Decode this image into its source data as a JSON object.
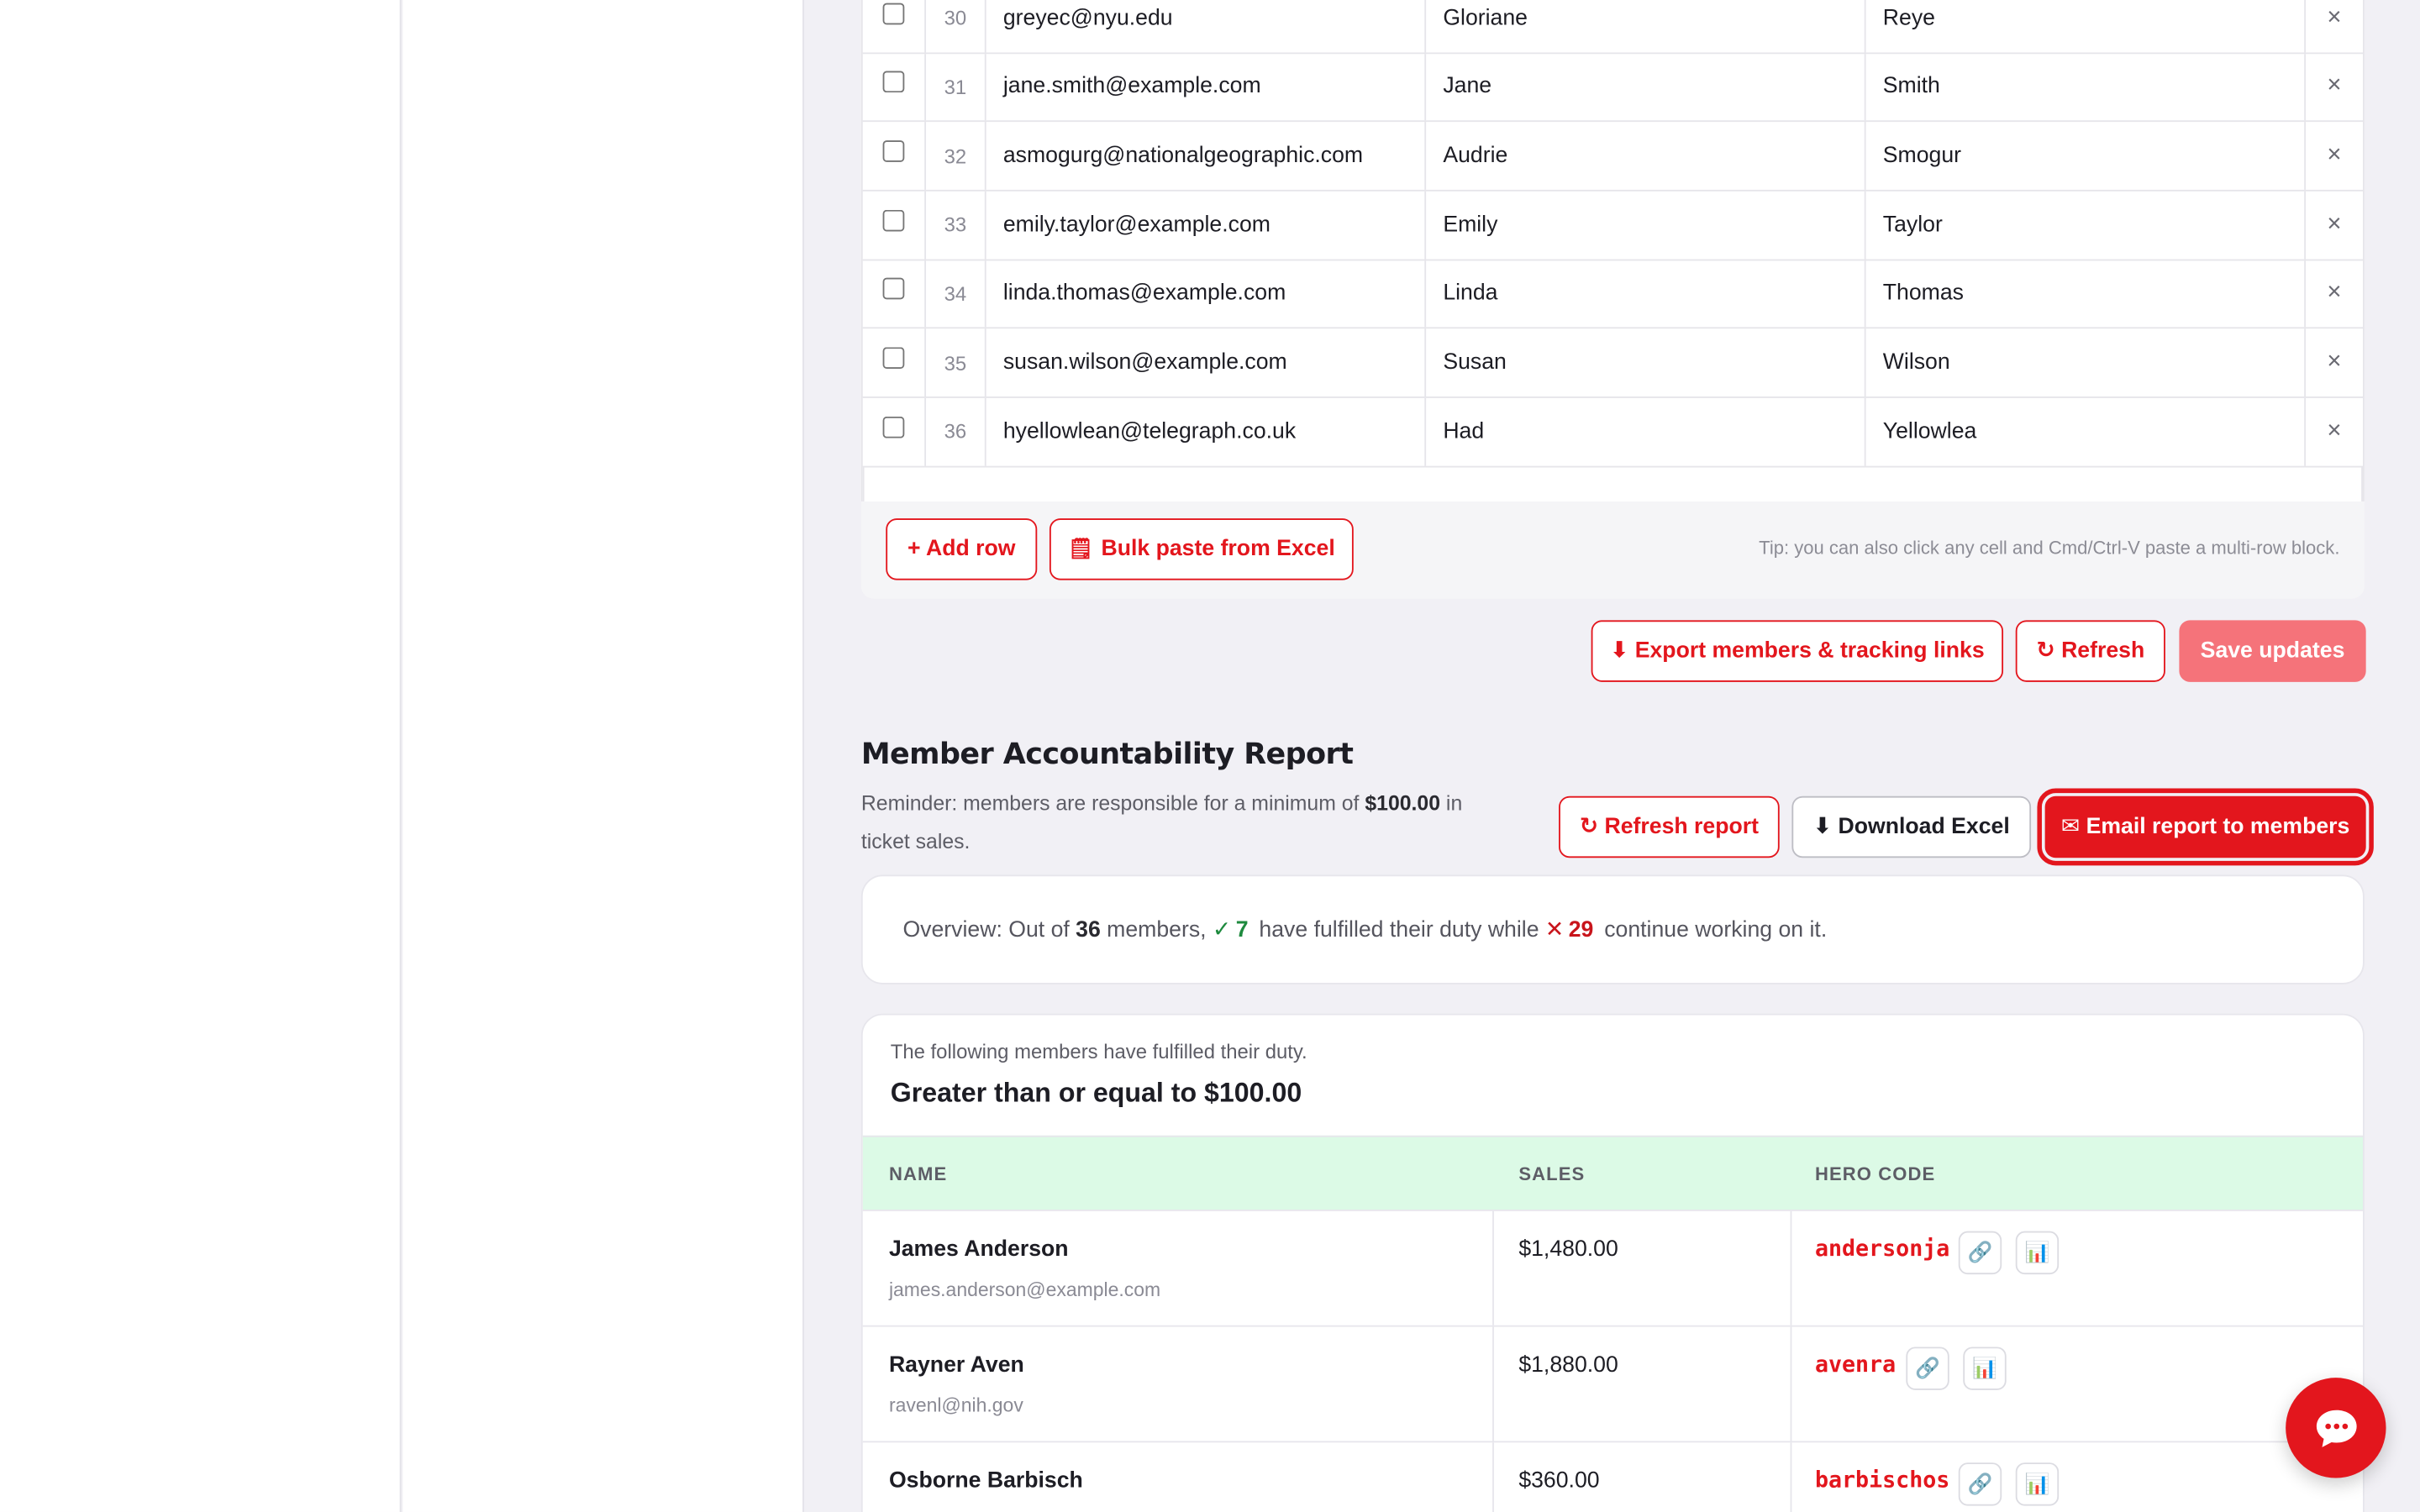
{
  "members_table": {
    "rows": [
      {
        "num": "30",
        "email": "greyec@nyu.edu",
        "first": "Gloriane",
        "last": "Reye"
      },
      {
        "num": "31",
        "email": "jane.smith@example.com",
        "first": "Jane",
        "last": "Smith"
      },
      {
        "num": "32",
        "email": "asmogurg@nationalgeographic.com",
        "first": "Audrie",
        "last": "Smogur"
      },
      {
        "num": "33",
        "email": "emily.taylor@example.com",
        "first": "Emily",
        "last": "Taylor"
      },
      {
        "num": "34",
        "email": "linda.thomas@example.com",
        "first": "Linda",
        "last": "Thomas"
      },
      {
        "num": "35",
        "email": "susan.wilson@example.com",
        "first": "Susan",
        "last": "Wilson"
      },
      {
        "num": "36",
        "email": "hyellowlean@telegraph.co.uk",
        "first": "Had",
        "last": "Yellowlea"
      }
    ],
    "delete_glyph": "×",
    "add_row_label": "+ Add row",
    "bulk_paste_label": "Bulk paste from Excel",
    "bulk_paste_icon": "🗒",
    "tip": "Tip: you can also click any cell and Cmd/Ctrl-V paste a multi-row block."
  },
  "actions": {
    "export_label": "⬇ Export members & tracking links",
    "refresh_label": "↻ Refresh",
    "save_label": "Save updates"
  },
  "report": {
    "title": "Member Accountability Report",
    "reminder_prefix": "Reminder: members are responsible for a minimum of",
    "reminder_amount": "$100.00",
    "reminder_suffix": "in ticket sales.",
    "refresh_report_label": "↻ Refresh report",
    "download_excel_label": "⬇ Download Excel",
    "email_report_label": "✉ Email report to members",
    "overview": {
      "prefix": "Overview: Out of",
      "total": "36",
      "members_word": "members,",
      "fulfilled_glyph": "✓",
      "fulfilled": "7",
      "middle": "have fulfilled their duty while",
      "pending_glyph": "✕",
      "pending": "29",
      "suffix": "continue working on it."
    },
    "fulfilled_section": {
      "subtitle": "The following members have fulfilled their duty.",
      "title": "Greater than or equal to $100.00",
      "headers": {
        "name": "NAME",
        "sales": "SALES",
        "hero": "HERO CODE"
      },
      "rows": [
        {
          "name": "James Anderson",
          "email": "james.anderson@example.com",
          "sales": "$1,480.00",
          "hero": "andersonja"
        },
        {
          "name": "Rayner Aven",
          "email": "ravenl@nih.gov",
          "sales": "$1,880.00",
          "hero": "avenra"
        },
        {
          "name": "Osborne Barbisch",
          "email": "",
          "sales": "$360.00",
          "hero": "barbischos"
        }
      ]
    }
  },
  "colors": {
    "brand_red": "#e3161d",
    "save_disabled": "#f5737a",
    "header_green": "#dcfae6"
  }
}
